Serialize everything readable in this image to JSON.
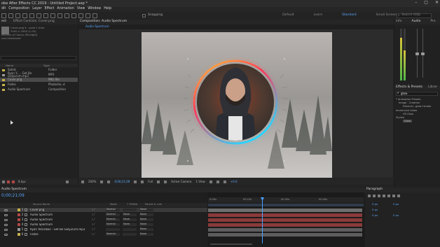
{
  "app": {
    "title": "obe After Effects CC 2019 - Untitled Project.aep *"
  },
  "menu": [
    "dit",
    "Composition",
    "Layer",
    "Effect",
    "Animation",
    "View",
    "Window",
    "Help"
  ],
  "workspaces": {
    "items": [
      "Default",
      "Learn",
      "Standard",
      "Small Screen",
      "Libraries"
    ],
    "active": "Standard"
  },
  "search": {
    "placeholder": "Search Help"
  },
  "toolbar": {
    "snapping": "Snapping"
  },
  "project_panel": {
    "tabs": [
      "ect",
      "Effect Controls: Cover.png"
    ],
    "info_name": "Cover.png ▾ , used 1 time",
    "info_size": "2000 x 2000 (1.00)",
    "info_colors": "Millions of Colors (Straight)",
    "info_interlace": "non-interlaced",
    "col_name": "Name",
    "col_type": "Type",
    "items": [
      {
        "name": "Solids",
        "type": "Folder",
        "color": "#c8b34a"
      },
      {
        "name": "Ryan Y... - Get Be Golyurum.mp3",
        "type": "MP3",
        "color": "#9a9a9a"
      },
      {
        "name": "Cover.png",
        "type": "PNG file",
        "color": "#c8b34a"
      },
      {
        "name": "Fedes",
        "type": "Photosho..d",
        "color": "#c8b34a"
      },
      {
        "name": "Audio Spectrum",
        "type": "Composition",
        "color": "#c8b34a"
      }
    ],
    "bpc": "8 bpc"
  },
  "comp_panel": {
    "tab": "Composition: Audio Spectrum",
    "breadcrumb": "Audio Spectrum",
    "zoom": "200%",
    "timecode": "0;00;21;09",
    "resolution": "Full",
    "camera": "Active Camera",
    "views": "1 View",
    "exposure": "+0.0"
  },
  "info_panel": {
    "tabs": [
      "Info",
      "Audio",
      "Pre"
    ],
    "levels": [
      0.82,
      0.58,
      0.3
    ]
  },
  "effects_panel": {
    "tabs": [
      "Effects & Presets",
      "Librar"
    ],
    "query": "glow",
    "items": [
      "* Animation Presets",
      "Image - Creative",
      "Dimensi...glow+shado",
      "Immersive Video",
      "VR Glow",
      "Stylize",
      "Glow"
    ]
  },
  "timeline": {
    "tab": "Audio Spectrum",
    "timecode": "0;00;21;09",
    "col_source": "Source Name",
    "col_mode": "Mode",
    "col_trkmat": "T  TrkMat",
    "col_parent": "Parent & Link",
    "ruler": [
      "0:00s",
      "00:15s",
      "00:30s",
      "00:45s"
    ],
    "playhead": 0.35,
    "layers": [
      {
        "idx": "1",
        "name": "Cover.png",
        "mode": "Normal",
        "trk": "",
        "parent": "None",
        "color": "#c8b34a",
        "bar": "#6e6e6e"
      },
      {
        "idx": "2",
        "name": "Audio Spectrum",
        "mode": "Normal",
        "trk": "None",
        "parent": "None",
        "color": "#b24747",
        "bar": "#8a3a3a"
      },
      {
        "idx": "3",
        "name": "Audio Spectrum",
        "mode": "Normal",
        "trk": "None",
        "parent": "None",
        "color": "#b24747",
        "bar": "#8a3a3a"
      },
      {
        "idx": "4",
        "name": "Audio Spectrum",
        "mode": "Normal",
        "trk": "None",
        "parent": "None",
        "color": "#b24747",
        "bar": "#8a3a3a"
      },
      {
        "idx": "5",
        "name": "Ryan Yelcinbas - Get Be Golyurum.mp3",
        "mode": "",
        "trk": "",
        "parent": "None",
        "color": "#9a9a9a",
        "bar": "#5d5d5d"
      },
      {
        "idx": "6",
        "name": "Fedes",
        "mode": "Normal",
        "trk": "",
        "parent": "None",
        "color": "#c8b34a",
        "bar": "#5d5d5d"
      }
    ]
  },
  "paragraph_panel": {
    "tab": "Paragraph",
    "fields": [
      "0 px",
      "0 px",
      "0 px",
      "0 px",
      "0 px"
    ]
  },
  "colors": {
    "accent": "#5aa7ff",
    "ring_top": "#ffcc33",
    "ring_left": "#ff3a5c",
    "ring_bottom": "#2ad4ff"
  }
}
